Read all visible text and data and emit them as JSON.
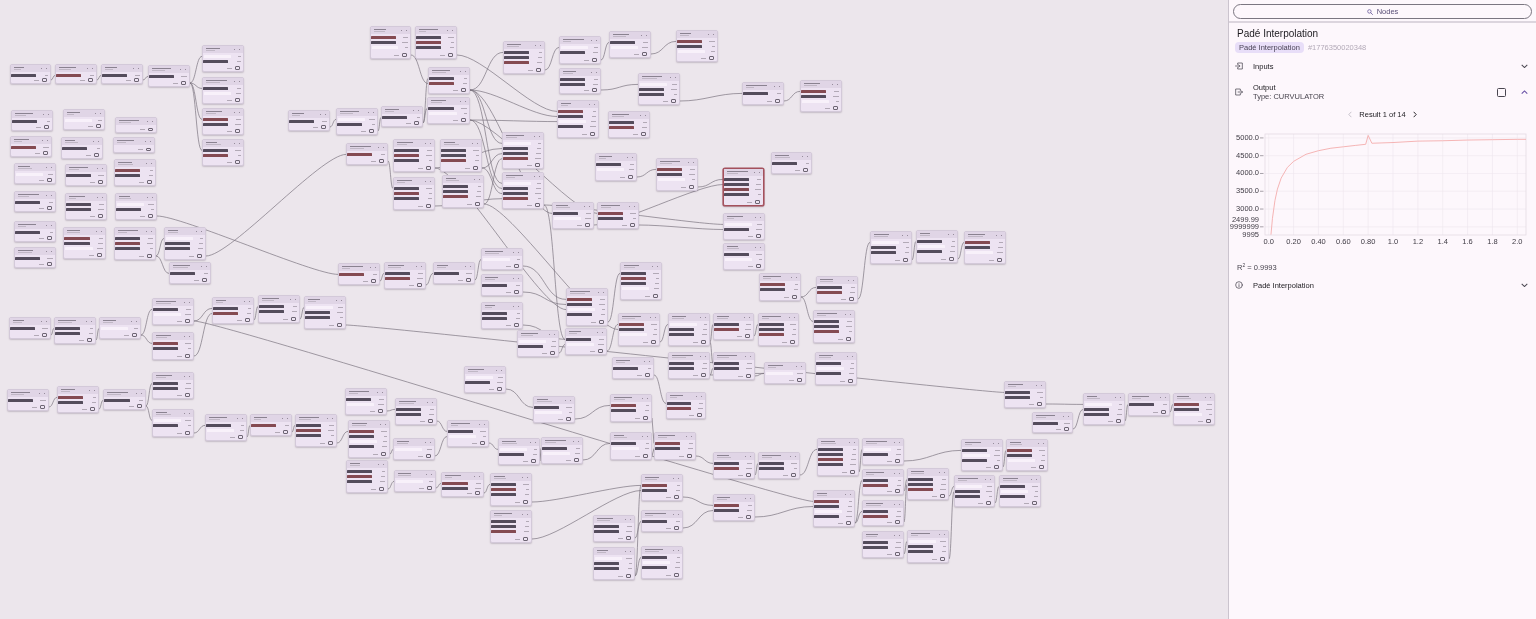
{
  "canvas": {
    "nodes": [
      {
        "selected": false
      },
      {
        "selected": false
      },
      {
        "selected": false
      },
      {
        "selected": false
      },
      {
        "selected": false
      },
      {
        "selected": false
      },
      {
        "selected": false
      },
      {
        "selected": false
      },
      {
        "selected": false
      },
      {
        "selected": false
      },
      {
        "selected": false
      },
      {
        "selected": false
      },
      {
        "selected": false
      },
      {
        "selected": false
      },
      {
        "selected": false
      },
      {
        "selected": false
      },
      {
        "selected": false
      },
      {
        "selected": false
      },
      {
        "selected": false
      },
      {
        "selected": false
      },
      {
        "selected": false
      },
      {
        "selected": false
      },
      {
        "selected": false
      },
      {
        "selected": false
      },
      {
        "selected": false
      },
      {
        "selected": false
      },
      {
        "selected": false
      },
      {
        "selected": false
      },
      {
        "selected": false
      },
      {
        "selected": false
      },
      {
        "selected": false
      },
      {
        "selected": false
      },
      {
        "selected": false
      },
      {
        "selected": false
      },
      {
        "selected": false
      },
      {
        "selected": false
      },
      {
        "selected": false
      },
      {
        "selected": false
      },
      {
        "selected": false
      },
      {
        "selected": false
      },
      {
        "selected": false
      },
      {
        "selected": false
      },
      {
        "selected": false
      },
      {
        "selected": false
      },
      {
        "selected": false
      },
      {
        "selected": false
      },
      {
        "selected": false
      },
      {
        "selected": false
      },
      {
        "selected": false
      },
      {
        "selected": false
      },
      {
        "selected": false
      },
      {
        "selected": false
      },
      {
        "selected": false
      },
      {
        "selected": true
      },
      {
        "selected": false
      },
      {
        "selected": false
      },
      {
        "selected": false
      },
      {
        "selected": false
      },
      {
        "selected": false
      },
      {
        "selected": false
      },
      {
        "selected": false
      },
      {
        "selected": false
      },
      {
        "selected": false
      },
      {
        "selected": false
      },
      {
        "selected": false
      },
      {
        "selected": false
      },
      {
        "selected": false
      },
      {
        "selected": false
      },
      {
        "selected": false
      },
      {
        "selected": false
      },
      {
        "selected": false
      },
      {
        "selected": false
      },
      {
        "selected": false
      },
      {
        "selected": false
      },
      {
        "selected": false
      },
      {
        "selected": false
      },
      {
        "selected": false
      },
      {
        "selected": false
      },
      {
        "selected": false
      },
      {
        "selected": false
      },
      {
        "selected": false
      },
      {
        "selected": false
      },
      {
        "selected": false
      },
      {
        "selected": false
      },
      {
        "selected": false
      },
      {
        "selected": false
      },
      {
        "selected": false
      },
      {
        "selected": false
      },
      {
        "selected": false
      },
      {
        "selected": false
      },
      {
        "selected": false
      },
      {
        "selected": false
      },
      {
        "selected": false
      },
      {
        "selected": false
      },
      {
        "selected": false
      },
      {
        "selected": false
      },
      {
        "selected": false
      },
      {
        "selected": false
      },
      {
        "selected": false
      },
      {
        "selected": false
      },
      {
        "selected": false
      },
      {
        "selected": false
      },
      {
        "selected": false
      },
      {
        "selected": false
      },
      {
        "selected": false
      },
      {
        "selected": false
      },
      {
        "selected": false
      },
      {
        "selected": false
      },
      {
        "selected": false
      },
      {
        "selected": false
      },
      {
        "selected": false
      },
      {
        "selected": false
      },
      {
        "selected": false
      },
      {
        "selected": false
      },
      {
        "selected": false
      },
      {
        "selected": false
      },
      {
        "selected": false
      },
      {
        "selected": false
      },
      {
        "selected": false
      },
      {
        "selected": false
      },
      {
        "selected": false
      },
      {
        "selected": false
      },
      {
        "selected": false
      },
      {
        "selected": false
      },
      {
        "selected": false
      },
      {
        "selected": false
      },
      {
        "selected": false
      },
      {
        "selected": false
      },
      {
        "selected": false
      },
      {
        "selected": false
      },
      {
        "selected": false
      },
      {
        "selected": false
      },
      {
        "selected": false
      },
      {
        "selected": false
      },
      {
        "selected": false
      },
      {
        "selected": false
      },
      {
        "selected": false
      },
      {
        "selected": false
      },
      {
        "selected": false
      },
      {
        "selected": false
      },
      {
        "selected": false
      },
      {
        "selected": false
      }
    ]
  },
  "panel": {
    "search_button": {
      "label": "Nodes"
    },
    "title": "Padé Interpolation",
    "chip": "Padé Interpolation",
    "node_id": "#1776350020348",
    "sections": [
      {
        "kind": "inputs",
        "label": "Inputs",
        "expanded": false
      },
      {
        "kind": "output",
        "label": "Output",
        "type": "Type: CURVULATOR",
        "checked": false,
        "expanded": true,
        "pager": {
          "label": "Result 1 of 14",
          "prev": {
            "disabled": true
          },
          "next": {
            "disabled": false
          }
        },
        "chart_data": {
          "type": "line",
          "grid": true,
          "x": [
            0.018,
            0.03,
            0.05,
            0.07,
            0.1,
            0.15,
            0.2,
            0.3,
            0.4,
            0.5,
            0.6,
            0.7,
            0.78,
            0.8,
            0.83,
            1.0,
            1.2,
            1.4,
            1.6,
            1.8,
            2.0,
            2.07
          ],
          "series": [
            {
              "color": "#f4adad",
              "values": [
                2280,
                2740,
                3240,
                3560,
                3870,
                4170,
                4340,
                4540,
                4640,
                4710,
                4750,
                4790,
                4820,
                5070,
                4850,
                4870,
                4910,
                4920,
                4940,
                4950,
                4960,
                4960
              ]
            }
          ],
          "xlim": [
            -0.03,
            2.07
          ],
          "ylim": [
            2270,
            5110
          ],
          "xticks": [
            {
              "value": 0,
              "label": "0.0"
            },
            {
              "value": 0.2,
              "label": "0.20"
            },
            {
              "value": 0.4,
              "label": "0.40"
            },
            {
              "value": 0.6,
              "label": "0.60"
            },
            {
              "value": 0.8,
              "label": "0.80"
            },
            {
              "value": 1.0,
              "label": "1.0"
            },
            {
              "value": 1.2,
              "label": "1.2"
            },
            {
              "value": 1.4,
              "label": "1.4"
            },
            {
              "value": 1.6,
              "label": "1.6"
            },
            {
              "value": 1.8,
              "label": "1.8"
            },
            {
              "value": 2.0,
              "label": "2.0"
            }
          ],
          "yticks": [
            {
              "value": 5000,
              "label": "5000.0"
            },
            {
              "value": 4500,
              "label": "4500.0"
            },
            {
              "value": 4000,
              "label": "4000.0"
            },
            {
              "value": 3500,
              "label": "3500.0"
            },
            {
              "value": 3000,
              "label": "3000.0"
            },
            {
              "value": 2499.9999999999995,
              "label": "2499.9999999999995"
            }
          ]
        },
        "r_squared": "R$^{2}$ = 0.9993"
      },
      {
        "kind": "info",
        "label": "Padé Interpolation",
        "expanded": false
      }
    ]
  }
}
